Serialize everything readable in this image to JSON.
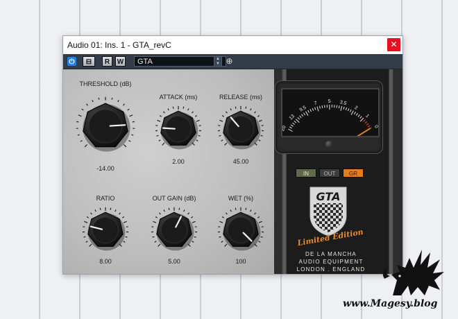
{
  "window": {
    "title": "Audio 01: Ins. 1 - GTA_revC",
    "close_icon": "close-icon"
  },
  "toolbar": {
    "power_icon": "power-icon",
    "bypass_icon": "bypass-icon",
    "read_label": "R",
    "write_label": "W",
    "preset_name": "GTA",
    "preset_arrows_icon": "up-down-arrows-icon",
    "preset_menu_icon": "globe-icon"
  },
  "knobs": {
    "threshold": {
      "label": "THRESHOLD (dB)",
      "value": "-14.00",
      "level": 0.82
    },
    "attack": {
      "label": "ATTACK (ms)",
      "value": "2.00",
      "level": 0.18
    },
    "release": {
      "label": "RELEASE (ms)",
      "value": "45.00",
      "level": 0.35
    },
    "ratio": {
      "label": "RATIO",
      "value": "8.00",
      "level": 0.22
    },
    "out_gain": {
      "label": "OUT GAIN (dB)",
      "value": "5.00",
      "level": 0.6
    },
    "wet": {
      "label": "WET (%)",
      "value": "100",
      "level": 1.0
    }
  },
  "meter": {
    "scale": [
      "20",
      "13",
      "9.5",
      "7",
      "5",
      "3.5",
      "2",
      "1",
      "0"
    ],
    "needle_value": "0"
  },
  "mode_buttons": {
    "in": "IN",
    "out": "OUT",
    "gr": "GR",
    "active": "GR"
  },
  "branding": {
    "logo_text": "GTA",
    "edition": "Limited Edition",
    "company_line1": "DE LA MANCHA",
    "company_line2": "AUDIO EQUIPMENT",
    "company_line3": "LONDON . ENGLAND"
  },
  "watermark": {
    "text": "www.Magesy.blog",
    "icon": "dragon-icon"
  },
  "colors": {
    "accent_orange": "#e57d1f",
    "close_red": "#e81123",
    "power_blue": "#2c7fd6",
    "toolbar_bg": "#333c48"
  }
}
